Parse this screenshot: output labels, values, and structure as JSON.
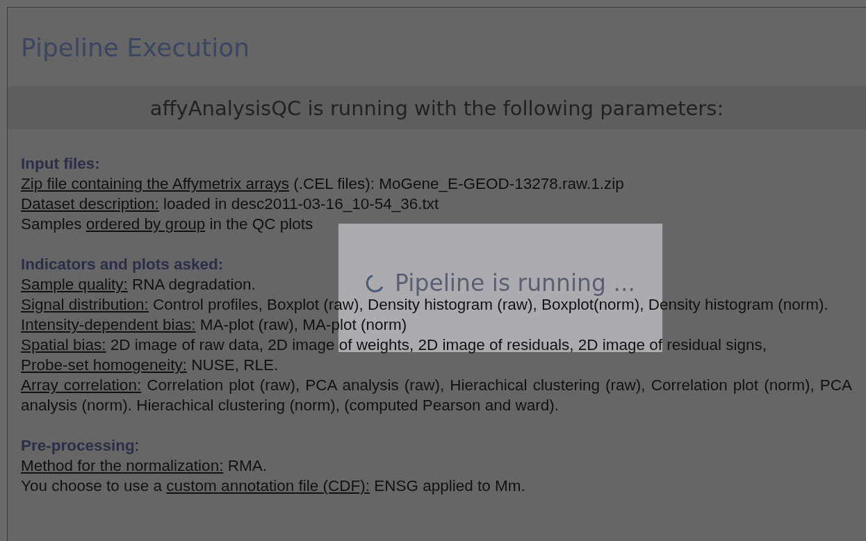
{
  "page": {
    "title": "Pipeline Execution"
  },
  "banner": "affyAnalysisQC is running with the following parameters:",
  "sections": [
    {
      "lines": [
        [
          {
            "kind": "bold",
            "text": "Input files:"
          }
        ],
        [
          {
            "kind": "underlined",
            "text": "Zip file containing the Affymetrix arrays"
          },
          {
            "kind": "plain",
            "text": " (.CEL files): MoGene_E-GEOD-13278.raw.1.zip"
          }
        ],
        [
          {
            "kind": "underlined",
            "text": "Dataset description:"
          },
          {
            "kind": "plain",
            "text": " loaded in desc2011-03-16_10-54_36.txt"
          }
        ],
        [
          {
            "kind": "plain",
            "text": "Samples "
          },
          {
            "kind": "underlined",
            "text": "ordered by group"
          },
          {
            "kind": "plain",
            "text": " in the QC plots"
          }
        ]
      ]
    },
    {
      "lines": [
        [
          {
            "kind": "bold",
            "text": "Indicators and plots asked:"
          }
        ],
        [
          {
            "kind": "underlined",
            "text": "Sample quality:"
          },
          {
            "kind": "plain",
            "text": " RNA degradation."
          }
        ],
        [
          {
            "kind": "underlined",
            "text": "Signal distribution:"
          },
          {
            "kind": "plain",
            "text": " Control profiles, Boxplot (raw), Density histogram (raw), Boxplot(norm), Density histogram (norm)."
          }
        ],
        [
          {
            "kind": "underlined",
            "text": "Intensity-dependent bias:"
          },
          {
            "kind": "plain",
            "text": " MA-plot (raw), MA-plot (norm)"
          }
        ],
        [
          {
            "kind": "underlined",
            "text": "Spatial bias:"
          },
          {
            "kind": "plain",
            "text": " 2D image of raw data, 2D image of weights, 2D image of residuals, 2D image of residual signs,"
          }
        ],
        [
          {
            "kind": "underlined",
            "text": "Probe-set homogeneity:"
          },
          {
            "kind": "plain",
            "text": " NUSE, RLE."
          }
        ],
        [
          {
            "kind": "underlined",
            "text": "Array correlation:"
          },
          {
            "kind": "plain",
            "text": " Correlation plot (raw), PCA analysis (raw), Hierachical clustering (raw), Correlation plot (norm), PCA analysis (norm). Hierachical clustering (norm), (computed Pearson and ward)."
          }
        ]
      ]
    },
    {
      "lines": [
        [
          {
            "kind": "bold",
            "text": "Pre-processing"
          },
          {
            "kind": "plain",
            "text": ":"
          }
        ],
        [
          {
            "kind": "underlined",
            "text": "Method for the normalization:"
          },
          {
            "kind": "plain",
            "text": " RMA."
          }
        ],
        [
          {
            "kind": "plain",
            "text": "You choose to use a "
          },
          {
            "kind": "underlined",
            "text": "custom annotation file (CDF):"
          },
          {
            "kind": "plain",
            "text": " ENSG applied to Mm."
          }
        ]
      ]
    }
  ],
  "modal": {
    "message": "Pipeline is running ..."
  }
}
